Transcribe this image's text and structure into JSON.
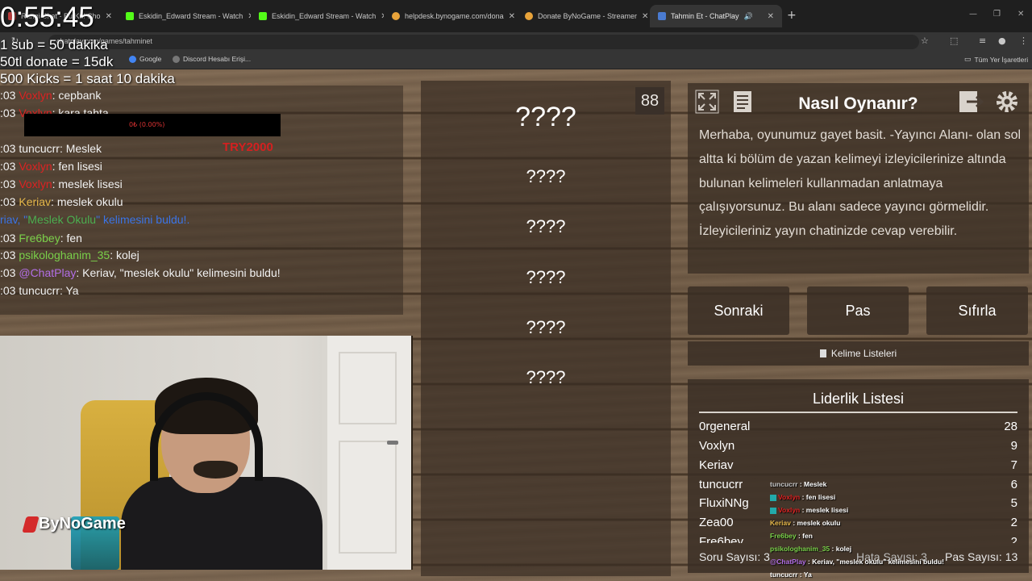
{
  "browser": {
    "tabs": [
      {
        "label": "Rangi Chat - Bu Kul Cho",
        "icon_color": "#b83a3a"
      },
      {
        "label": "Eskidin_Edward Stream - Watch",
        "icon_color": "#53fc18"
      },
      {
        "label": "Eskidin_Edward Stream - Watch",
        "icon_color": "#53fc18"
      },
      {
        "label": "helpdesk.bynogame.com/dona",
        "icon_color": "#e8a33a"
      },
      {
        "label": "Donate ByNoGame - Streamer",
        "icon_color": "#e8a33a"
      },
      {
        "label": "Tahmin Et - ChatPlay",
        "icon_color": "#4a7bd1"
      }
    ],
    "url": "chatplay.com/games/tahminet",
    "bookmarks": [
      "Google",
      "Discord Hesabı Erişi..."
    ],
    "bookmarks_right": "Tüm Yer İşaretleri"
  },
  "overlay": {
    "timer": "0:55:45",
    "rules": [
      "1 sub = 50 dakika",
      "50tl donate = 15dk",
      "500 Kicks  = 1 saat 10 dakika"
    ],
    "donation_amount": "TRY2000",
    "donation_bar_text": "0₺ (0.00%)"
  },
  "chat": [
    {
      "prefix": ":03",
      "user": "Voxlyn",
      "user_color": "#d22",
      "msg": ": cepbank"
    },
    {
      "prefix": ":03",
      "user": "Voxlyn",
      "user_color": "#d22",
      "msg": ": kara tahta"
    },
    {
      "prefix": ":03",
      "user": "tuncucrr",
      "user_color": "#f2f2f2",
      "msg": ": Meslek"
    },
    {
      "prefix": ":03",
      "user": "Voxlyn",
      "user_color": "#d22",
      "msg": ": fen lisesi"
    },
    {
      "prefix": ":03",
      "user": "Voxlyn",
      "user_color": "#d22",
      "msg": ": meslek lisesi"
    },
    {
      "prefix": ":03",
      "user": "Keriav",
      "user_color": "#e6b84a",
      "msg": ": meslek okulu"
    },
    {
      "prefix": "",
      "user": "riav, \"",
      "user_color": "#3b74e6",
      "msg": "\" kelimesini buldu!."
    },
    {
      "prefix": ":03",
      "user": "Fre6bey",
      "user_color": "#7ad04a",
      "msg": ": fen"
    },
    {
      "prefix": ":03",
      "user": "psikologhanim_35",
      "user_color": "#7ad04a",
      "msg": ": kolej"
    },
    {
      "prefix": ":03",
      "user": "@ChatPlay",
      "user_color": "#b26ee6",
      "msg": ": Keriav, \"meslek okulu\" kelimesini buldu!"
    },
    {
      "prefix": ":03",
      "user": "tuncucrr",
      "user_color": "#f2f2f2",
      "msg": ": Ya"
    }
  ],
  "chat_found_word": "Meslek Okulu",
  "game": {
    "counter": "88",
    "main_word": "????",
    "hidden_words": [
      "????",
      "????",
      "????",
      "????",
      "????"
    ]
  },
  "howto": {
    "title": "Nasıl Oynanır?",
    "text": "Merhaba, oyunumuz gayet basit. -Yayıncı Alanı- olan sol altta ki bölüm de yazan kelimeyi izleyicilerinize altında bulunan kelimeleri kullanmadan anlatmaya çalışıyorsunuz. Bu alanı sadece yayıncı görmelidir. İzleyicileriniz yayın chatinizde cevap verebilir."
  },
  "buttons": {
    "next": "Sonraki",
    "pass": "Pas",
    "reset": "Sıfırla",
    "word_lists": "Kelime Listeleri"
  },
  "leaderboard": {
    "title": "Liderlik Listesi",
    "rows": [
      {
        "name": "0rgeneral",
        "score": "28"
      },
      {
        "name": "Voxlyn",
        "score": "9"
      },
      {
        "name": "Keriav",
        "score": "7"
      },
      {
        "name": "tuncucrr",
        "score": "6"
      },
      {
        "name": "FluxiNNg",
        "score": "5"
      },
      {
        "name": "Zea00",
        "score": "2"
      },
      {
        "name": "Fre6bey",
        "score": "2"
      }
    ],
    "question_count": "Soru Sayısı: 3",
    "error_count": "Hata Sayısı: 3",
    "pass_count": "Pas Sayısı: 13"
  },
  "mini_chat": [
    {
      "user": "tuncucrr",
      "color": "#c9c9c9",
      "msg": " : Meslek",
      "badge": false
    },
    {
      "user": "Voxlyn",
      "color": "#d22",
      "msg": " : fen lisesi",
      "badge": true
    },
    {
      "user": "Voxlyn",
      "color": "#d22",
      "msg": " : meslek lisesi",
      "badge": true
    },
    {
      "user": "Keriav",
      "color": "#e6b84a",
      "msg": " : meslek okulu",
      "badge": false
    },
    {
      "user": "Fre6bey",
      "color": "#7ad04a",
      "msg": " : fen",
      "badge": false
    },
    {
      "user": "psikologhanim_35",
      "color": "#7ad04a",
      "msg": " : kolej",
      "badge": false
    },
    {
      "user": "@ChatPlay",
      "color": "#b26ee6",
      "msg": " : Keriav, \"meslek okulu\" kelimesini buldu!",
      "badge": false
    },
    {
      "user": "tuncucrr",
      "color": "#fff",
      "msg": " : Ya",
      "badge": false
    }
  ],
  "brand": "ByNoGame"
}
